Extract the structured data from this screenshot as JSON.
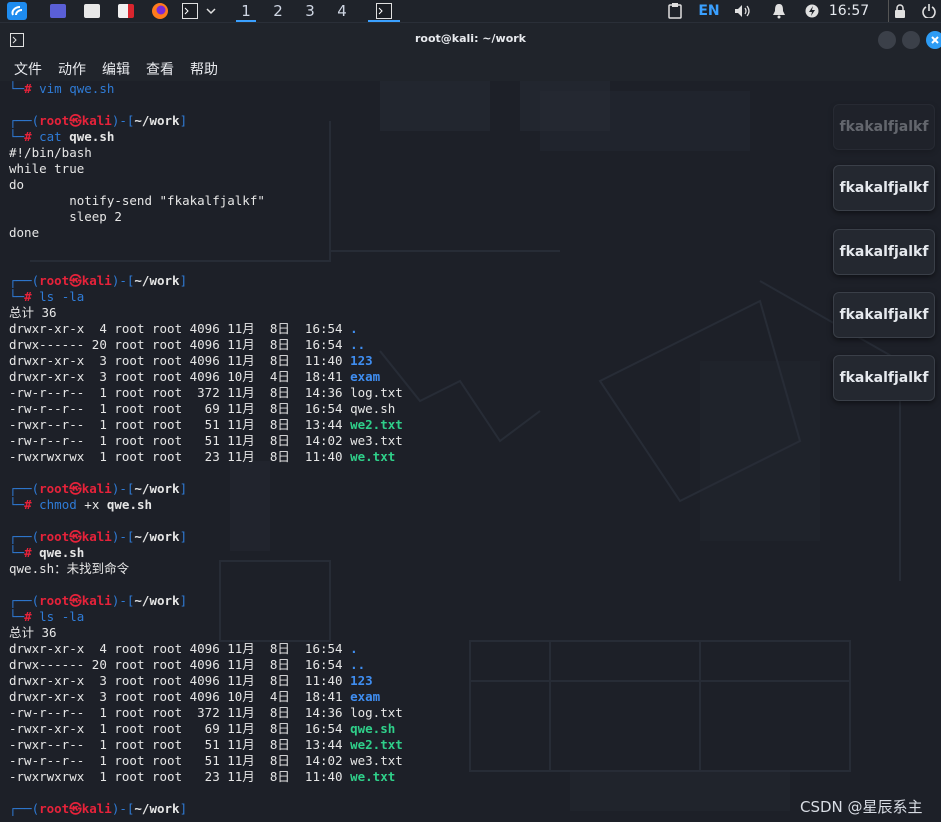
{
  "panel": {
    "workspaces": [
      "1",
      "2",
      "3",
      "4"
    ],
    "lang": "EN",
    "clock": "16:57"
  },
  "window": {
    "title": "root@kali: ~/work"
  },
  "menu": [
    "文件",
    "动作",
    "编辑",
    "查看",
    "帮助"
  ],
  "terminal": {
    "user": "root",
    "host": "kali",
    "cwd": "~/work",
    "lines": [
      {
        "t": "cmdend",
        "cmd": "vim qwe.sh"
      },
      {
        "t": "blank"
      },
      {
        "t": "prompt"
      },
      {
        "t": "cmd",
        "cmd": "cat",
        "arg": "qwe.sh"
      },
      {
        "t": "out",
        "text": "#!/bin/bash"
      },
      {
        "t": "out",
        "text": "while true"
      },
      {
        "t": "out",
        "text": "do"
      },
      {
        "t": "out",
        "text": "        notify-send \"fkakalfjalkf\""
      },
      {
        "t": "out",
        "text": "        sleep 2"
      },
      {
        "t": "out",
        "text": "done"
      },
      {
        "t": "blank"
      },
      {
        "t": "blank"
      },
      {
        "t": "prompt"
      },
      {
        "t": "cmd",
        "cmd": "ls -la"
      },
      {
        "t": "out",
        "text": "总计 36"
      },
      {
        "t": "ls",
        "perm": "drwxr-xr-x",
        "rest": "  4 root root 4096 11月  8日  16:54 ",
        "name": ".",
        "k": "dir"
      },
      {
        "t": "ls",
        "perm": "drwx------",
        "rest": " 20 root root 4096 11月  8日  16:54 ",
        "name": "..",
        "k": "dir"
      },
      {
        "t": "ls",
        "perm": "drwxr-xr-x",
        "rest": "  3 root root 4096 11月  8日  11:40 ",
        "name": "123",
        "k": "dir"
      },
      {
        "t": "ls",
        "perm": "drwxr-xr-x",
        "rest": "  3 root root 4096 10月  4日  18:41 ",
        "name": "exam",
        "k": "dir"
      },
      {
        "t": "ls",
        "perm": "-rw-r--r--",
        "rest": "  1 root root  372 11月  8日  14:36 ",
        "name": "log.txt",
        "k": "file"
      },
      {
        "t": "ls",
        "perm": "-rw-r--r--",
        "rest": "  1 root root   69 11月  8日  16:54 ",
        "name": "qwe.sh",
        "k": "file"
      },
      {
        "t": "ls",
        "perm": "-rwxr--r--",
        "rest": "  1 root root   51 11月  8日  13:44 ",
        "name": "we2.txt",
        "k": "exe"
      },
      {
        "t": "ls",
        "perm": "-rw-r--r--",
        "rest": "  1 root root   51 11月  8日  14:02 ",
        "name": "we3.txt",
        "k": "file"
      },
      {
        "t": "ls",
        "perm": "-rwxrwxrwx",
        "rest": "  1 root root   23 11月  8日  11:40 ",
        "name": "we.txt",
        "k": "exe"
      },
      {
        "t": "blank"
      },
      {
        "t": "prompt"
      },
      {
        "t": "cmd",
        "cmd": "chmod",
        "mid": " +x ",
        "arg": "qwe.sh"
      },
      {
        "t": "blank"
      },
      {
        "t": "prompt"
      },
      {
        "t": "cmd",
        "arg": "qwe.sh"
      },
      {
        "t": "out",
        "text": "qwe.sh：未找到命令"
      },
      {
        "t": "blank"
      },
      {
        "t": "prompt"
      },
      {
        "t": "cmd",
        "cmd": "ls -la"
      },
      {
        "t": "out",
        "text": "总计 36"
      },
      {
        "t": "ls",
        "perm": "drwxr-xr-x",
        "rest": "  4 root root 4096 11月  8日  16:54 ",
        "name": ".",
        "k": "dir"
      },
      {
        "t": "ls",
        "perm": "drwx------",
        "rest": " 20 root root 4096 11月  8日  16:54 ",
        "name": "..",
        "k": "dir"
      },
      {
        "t": "ls",
        "perm": "drwxr-xr-x",
        "rest": "  3 root root 4096 11月  8日  11:40 ",
        "name": "123",
        "k": "dir"
      },
      {
        "t": "ls",
        "perm": "drwxr-xr-x",
        "rest": "  3 root root 4096 10月  4日  18:41 ",
        "name": "exam",
        "k": "dir"
      },
      {
        "t": "ls",
        "perm": "-rw-r--r--",
        "rest": "  1 root root  372 11月  8日  14:36 ",
        "name": "log.txt",
        "k": "file"
      },
      {
        "t": "ls",
        "perm": "-rwxr-xr-x",
        "rest": "  1 root root   69 11月  8日  16:54 ",
        "name": "qwe.sh",
        "k": "exe"
      },
      {
        "t": "ls",
        "perm": "-rwxr--r--",
        "rest": "  1 root root   51 11月  8日  13:44 ",
        "name": "we2.txt",
        "k": "exe"
      },
      {
        "t": "ls",
        "perm": "-rw-r--r--",
        "rest": "  1 root root   51 11月  8日  14:02 ",
        "name": "we3.txt",
        "k": "file"
      },
      {
        "t": "ls",
        "perm": "-rwxrwxrwx",
        "rest": "  1 root root   23 11月  8日  11:40 ",
        "name": "we.txt",
        "k": "exe"
      },
      {
        "t": "blank"
      },
      {
        "t": "prompt"
      }
    ]
  },
  "notifications": [
    {
      "text": "fkakalfjalkf",
      "faded": true
    },
    {
      "text": "fkakalfjalkf",
      "faded": false
    },
    {
      "text": "fkakalfjalkf",
      "faded": false
    },
    {
      "text": "fkakalfjalkf",
      "faded": false
    },
    {
      "text": "fkakalfjalkf",
      "faded": false
    }
  ],
  "watermark": "CSDN @星辰系主"
}
